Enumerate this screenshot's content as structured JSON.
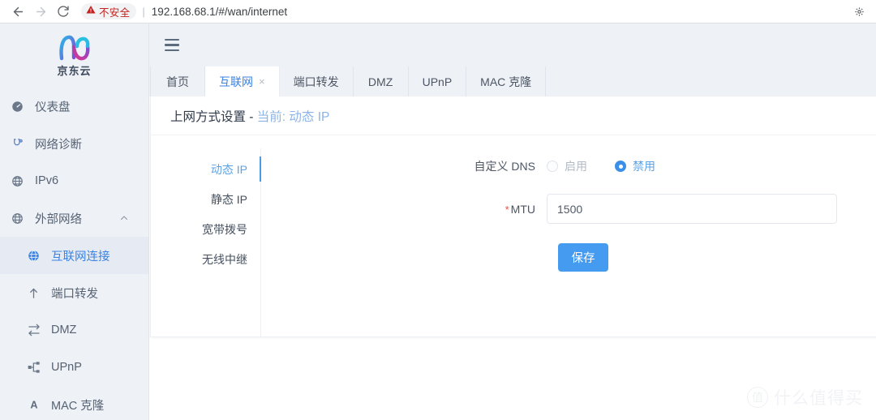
{
  "browser": {
    "back_icon": "back-arrow-icon",
    "forward_icon": "forward-arrow-icon",
    "reload_icon": "reload-icon",
    "security_warning": "不安全",
    "security_icon": "warning-triangle-icon",
    "url": "192.168.68.1/#/wan/internet",
    "separator": "|",
    "settings_icon": "gear-icon"
  },
  "sidebar": {
    "logo_text": "京东云",
    "items": [
      {
        "label": "仪表盘",
        "icon": "dashboard-icon",
        "active": false
      },
      {
        "label": "网络诊断",
        "icon": "stethoscope-icon",
        "active": false
      },
      {
        "label": "IPv6",
        "icon": "globe-grid-icon",
        "active": false
      },
      {
        "label": "外部网络",
        "icon": "globe-icon",
        "active": false,
        "chevron": "chevron-up-icon"
      },
      {
        "label": "互联网连接",
        "icon": "globe-blue-icon",
        "active": true,
        "sub": true
      },
      {
        "label": "端口转发",
        "icon": "arrow-up-icon",
        "active": false,
        "sub": true
      },
      {
        "label": "DMZ",
        "icon": "swap-arrows-icon",
        "active": false,
        "sub": true
      },
      {
        "label": "UPnP",
        "icon": "sitemap-icon",
        "active": false,
        "sub": true
      },
      {
        "label": "MAC 克隆",
        "icon": "letter-a-icon",
        "active": false,
        "sub": true
      }
    ]
  },
  "topbar": {
    "menu_icon": "hamburger-icon"
  },
  "tabs": [
    {
      "label": "首页",
      "active": false,
      "closable": false
    },
    {
      "label": "互联网",
      "active": true,
      "closable": true,
      "close_glyph": "×"
    },
    {
      "label": "端口转发",
      "active": false,
      "closable": false
    },
    {
      "label": "DMZ",
      "active": false,
      "closable": false
    },
    {
      "label": "UPnP",
      "active": false,
      "closable": false
    },
    {
      "label": "MAC 克隆",
      "active": false,
      "closable": false
    }
  ],
  "card": {
    "title_main": "上网方式设置 - ",
    "title_sub": "当前: 动态 IP",
    "vtabs": [
      {
        "label": "动态 IP",
        "active": true
      },
      {
        "label": "静态 IP",
        "active": false
      },
      {
        "label": "宽带拨号",
        "active": false
      },
      {
        "label": "无线中继",
        "active": false
      }
    ],
    "form": {
      "dns_label": "自定义 DNS",
      "dns_options": [
        {
          "label": "启用",
          "selected": false
        },
        {
          "label": "禁用",
          "selected": true
        }
      ],
      "mtu_label": "MTU",
      "mtu_required_marker": "*",
      "mtu_value": "1500",
      "mtu_placeholder": "",
      "save_label": "保存"
    }
  },
  "watermark": {
    "badge": "值",
    "text": "什么值得买"
  },
  "colors": {
    "accent_blue": "#3b82e0",
    "button_blue": "#459bf0",
    "sidebar_bg": "#eef1f6",
    "warning_red": "#c5221f",
    "required_red": "#e8504a"
  }
}
